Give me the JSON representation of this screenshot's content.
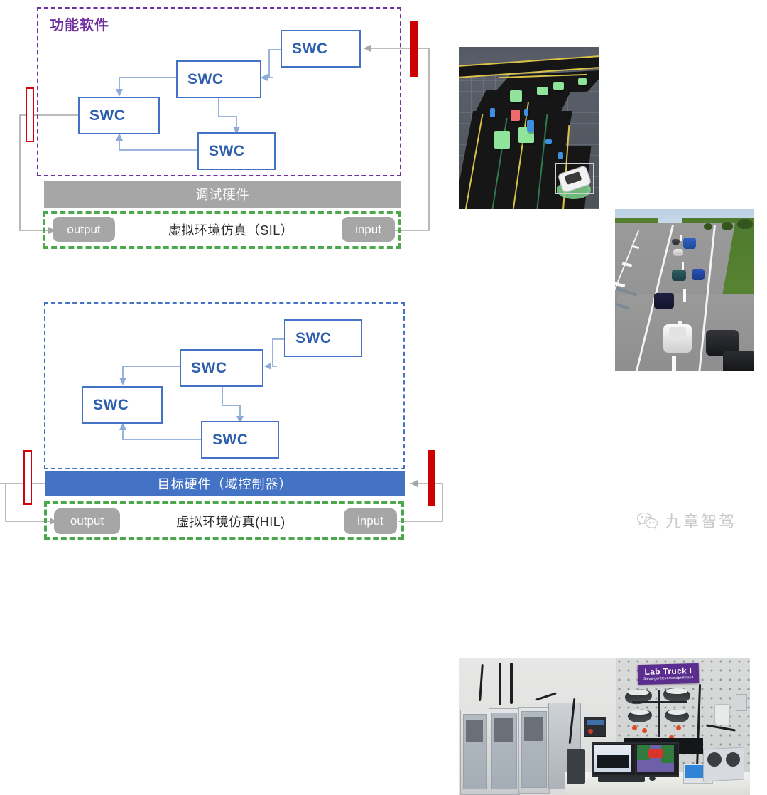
{
  "diagrams": {
    "sil": {
      "container_label": "功能软件",
      "swc_label": "SWC",
      "swc_blocks": [
        {
          "id": "sil-swc-top-right",
          "label": "SWC"
        },
        {
          "id": "sil-swc-center",
          "label": "SWC"
        },
        {
          "id": "sil-swc-left",
          "label": "SWC"
        },
        {
          "id": "sil-swc-bottom",
          "label": "SWC"
        }
      ],
      "hardware_bar": "调试硬件",
      "sim_label": "虚拟环境仿真（SIL）",
      "output_label": "output",
      "input_label": "input",
      "colors": {
        "container_border": "#7030A0",
        "swc_border": "#4472C4",
        "swc_text": "#2E5FAC",
        "wire": "#8EAADB",
        "loop_wire": "#A6A6A6",
        "hardware_bar_bg": "#A6A6A6",
        "sim_border": "#4CA84C",
        "pill_bg": "#A6A6A6",
        "marker_hollow": "#D8000C",
        "marker_solid": "#CC0000"
      }
    },
    "hil": {
      "container_label": "",
      "swc_blocks": [
        {
          "id": "hil-swc-top-right",
          "label": "SWC"
        },
        {
          "id": "hil-swc-center",
          "label": "SWC"
        },
        {
          "id": "hil-swc-left",
          "label": "SWC"
        },
        {
          "id": "hil-swc-bottom",
          "label": "SWC"
        }
      ],
      "hardware_bar": "目标硬件（域控制器）",
      "sim_label": "虚拟环境仿真(HIL)",
      "output_label": "output",
      "input_label": "input",
      "colors": {
        "container_border": "#4472C4",
        "hardware_bar_bg": "#4472C4",
        "sim_border": "#4CA84C",
        "pill_bg": "#A6A6A6",
        "marker_hollow": "#D8000C",
        "marker_solid": "#CC0000"
      }
    }
  },
  "media": {
    "sim_birdseye": {
      "name": "synthetic-sensor-view",
      "description": "3D bird's-eye synthetic driving scene with boxed vehicles"
    },
    "sim_highway": {
      "name": "photoreal-highway-view",
      "description": "Photorealistic highway simulation with traffic"
    },
    "lab_photo": {
      "name": "hil-lab-bench-photo",
      "sign_title": "Lab Truck I",
      "sign_subtitle": "Steuergeräteverbundprüfstand"
    }
  },
  "watermark": {
    "text": "九章智驾",
    "icon": "wechat-icon"
  }
}
